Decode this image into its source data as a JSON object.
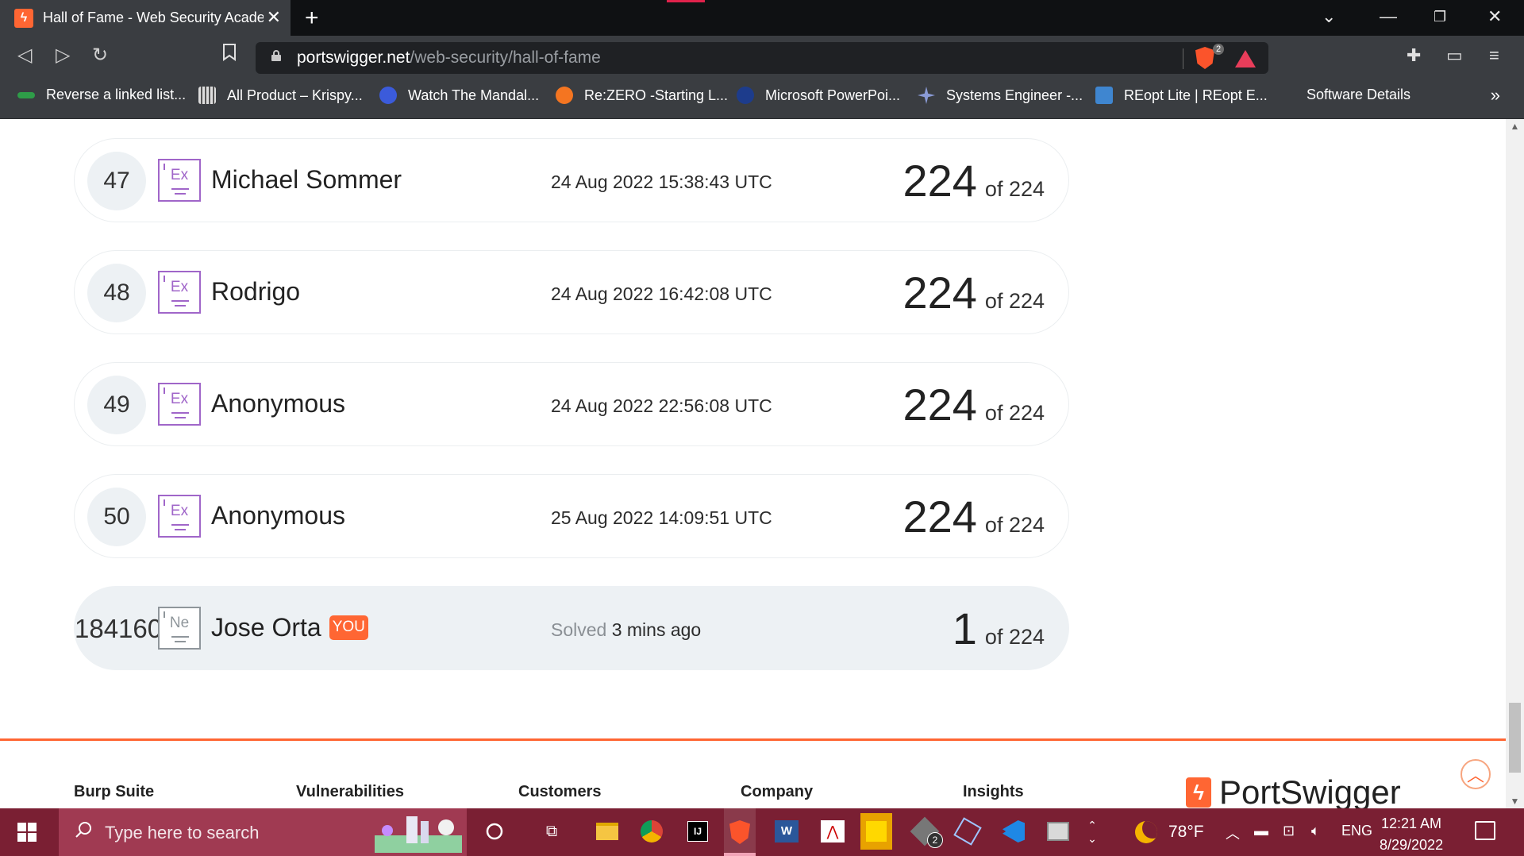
{
  "browser": {
    "tab_title": "Hall of Fame - Web Security Academy",
    "favicon": "portswigger-bolt-icon",
    "url_host": "portswigger.net",
    "url_path": "/web-security/hall-of-fame",
    "shield_count": "2",
    "bookmarks": [
      {
        "label": "Reverse a linked list...",
        "icon": "link-icon",
        "color": "#2e9c48"
      },
      {
        "label": "All Product – Krispy...",
        "icon": "krispy-icon",
        "color": "#9a9a9a"
      },
      {
        "label": "Watch The Mandal...",
        "icon": "play-icon",
        "color": "#3b5bdb"
      },
      {
        "label": "Re:ZERO -Starting L...",
        "icon": "crunchyroll-icon",
        "color": "#f47521"
      },
      {
        "label": "Microsoft PowerPoi...",
        "icon": "nasa-icon",
        "color": "#1d3c8c"
      },
      {
        "label": "Systems Engineer -...",
        "icon": "sparkle-icon",
        "color": "#8a9bd6"
      },
      {
        "label": "REopt Lite | REopt E...",
        "icon": "reopt-icon",
        "color": "#3f86d0"
      },
      {
        "label": "Software Details",
        "icon": "",
        "color": ""
      }
    ]
  },
  "leaderboard": [
    {
      "rank": "47",
      "level": "Ex",
      "name": "Michael Sommer",
      "date": "24 Aug 2022 15:38:43 UTC",
      "solved": "224",
      "total": "of 224"
    },
    {
      "rank": "48",
      "level": "Ex",
      "name": "Rodrigo",
      "date": "24 Aug 2022 16:42:08 UTC",
      "solved": "224",
      "total": "of 224"
    },
    {
      "rank": "49",
      "level": "Ex",
      "name": "Anonymous",
      "date": "24 Aug 2022 22:56:08 UTC",
      "solved": "224",
      "total": "of 224"
    },
    {
      "rank": "50",
      "level": "Ex",
      "name": "Anonymous",
      "date": "25 Aug 2022 14:09:51 UTC",
      "solved": "224",
      "total": "of 224"
    }
  ],
  "you": {
    "rank": "184160",
    "level": "Ne",
    "name": "Jose Orta",
    "badge": "YOU",
    "solved_label": "Solved",
    "solved_when": "3 mins ago",
    "solved": "1",
    "total": "of 224"
  },
  "footer": {
    "columns": [
      "Burp Suite",
      "Vulnerabilities",
      "Customers",
      "Company",
      "Insights"
    ],
    "logo_text": "PortSwigger"
  },
  "taskbar": {
    "search_placeholder": "Type here to search",
    "weather": "78°F",
    "language": "ENG",
    "time": "12:21 AM",
    "date": "8/29/2022",
    "badge_count": "2"
  },
  "colors": {
    "accent": "#ff6633",
    "expert_level": "#a066c9",
    "taskbar": "#7a1f33"
  }
}
